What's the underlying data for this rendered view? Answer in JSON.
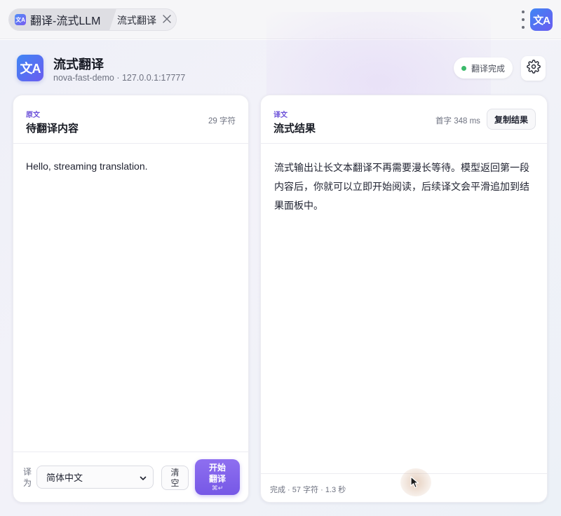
{
  "tabbar": {
    "app_tab_title": "翻译-流式LLM",
    "page_tab_label": "流式翻译",
    "logo_text": "文A"
  },
  "header": {
    "title": "流式翻译",
    "subtitle": "nova-fast-demo · 127.0.0.1:17777",
    "status": "翻译完成",
    "status_color": "#3cba6b",
    "logo_text": "文A"
  },
  "source_panel": {
    "kicker": "原文",
    "title": "待翻译内容",
    "char_count": "29 字符",
    "text": "Hello, streaming translation.",
    "target_label": "译为",
    "target_language": "简体中文",
    "clear_label": "清空",
    "start_label_line1": "开始",
    "start_label_line2": "翻译",
    "start_shortcut": "⌘↵"
  },
  "result_panel": {
    "kicker": "译文",
    "title": "流式结果",
    "latency": "首字 348 ms",
    "copy_label": "复制结果",
    "text": "流式输出让长文本翻译不再需要漫长等待。模型返回第一段内容后，你就可以立即开始阅读，后续译文会平滑追加到结果面板中。",
    "footer_stats": "完成 · 57 字符 · 1.3 秒"
  },
  "colors": {
    "accent": "#7658e6",
    "brand_gradient_start": "#3f86f4",
    "brand_gradient_end": "#6b5cf0"
  },
  "icons": {
    "tab_close": "close-icon",
    "menu": "kebab-menu-icon",
    "settings": "gear-icon",
    "select": "chevron-down-icon"
  }
}
